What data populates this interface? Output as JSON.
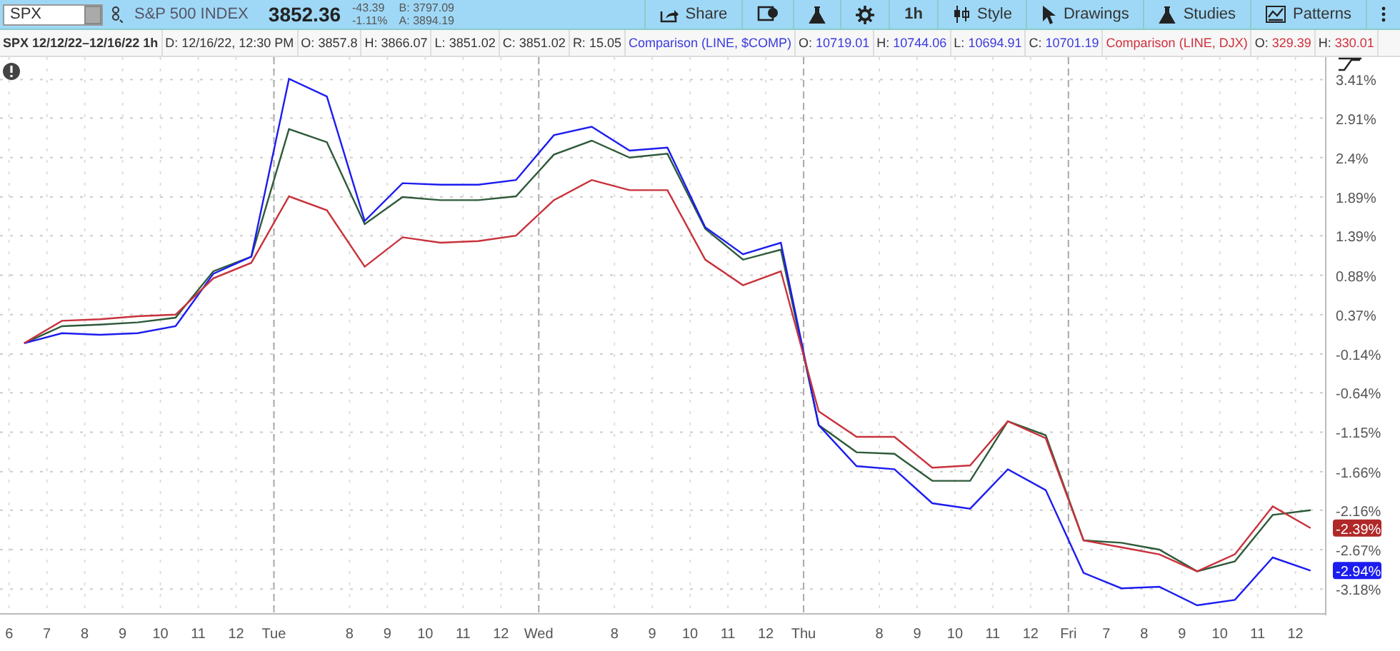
{
  "toolbar": {
    "symbol": "SPX",
    "description": "S&P 500 INDEX",
    "last": "3852.36",
    "change": "-43.39",
    "change_pct": "-1.11%",
    "bid": "B: 3797.09",
    "ask": "A: 3894.19",
    "buttons": [
      {
        "kind": "share",
        "label": "Share"
      },
      {
        "kind": "alert"
      },
      {
        "kind": "flask"
      },
      {
        "kind": "gear"
      },
      {
        "kind": "period",
        "label": "1h"
      },
      {
        "kind": "style",
        "label": "Style"
      },
      {
        "kind": "drawings",
        "label": "Drawings"
      },
      {
        "kind": "studies",
        "label": "Studies"
      },
      {
        "kind": "patterns",
        "label": "Patterns"
      },
      {
        "kind": "more"
      }
    ]
  },
  "info_bar": [
    {
      "kind": "title",
      "text": "SPX 12/12/22–12/16/22 1h"
    },
    {
      "kind": "field",
      "label": "D:",
      "value": "12/16/22, 12:30 PM"
    },
    {
      "kind": "field",
      "label": "O:",
      "value": "3857.8"
    },
    {
      "kind": "field",
      "label": "H:",
      "value": "3866.07"
    },
    {
      "kind": "field",
      "label": "L:",
      "value": "3851.02"
    },
    {
      "kind": "field",
      "label": "C:",
      "value": "3851.02"
    },
    {
      "kind": "field",
      "label": "R:",
      "value": "15.05"
    },
    {
      "kind": "comparison",
      "text": "Comparison (LINE, $COMP)",
      "color": "#3a3adf"
    },
    {
      "kind": "field",
      "label": "O:",
      "value": "10719.01",
      "color": "#3a3adf"
    },
    {
      "kind": "field",
      "label": "H:",
      "value": "10744.06",
      "color": "#3a3adf"
    },
    {
      "kind": "field",
      "label": "L:",
      "value": "10694.91",
      "color": "#3a3adf"
    },
    {
      "kind": "field",
      "label": "C:",
      "value": "10701.19",
      "color": "#3a3adf"
    },
    {
      "kind": "comparison",
      "text": "Comparison (LINE, DJX)",
      "color": "#d0303c"
    },
    {
      "kind": "field",
      "label": "O:",
      "value": "329.39",
      "color": "#d0303c"
    },
    {
      "kind": "field",
      "label": "H:",
      "value": "330.01",
      "color": "#d0303c"
    }
  ],
  "chart": {
    "price_badges": [
      {
        "text": "-2.39%",
        "color": "#b02828"
      },
      {
        "text": "-2.94%",
        "color": "#1c1cf0"
      }
    ],
    "chart_data": {
      "type": "line",
      "categories": [
        "6",
        "7",
        "8",
        "9",
        "10",
        "11",
        "12",
        "Tue",
        null,
        "8",
        "9",
        "10",
        "11",
        "12",
        "Wed",
        null,
        "8",
        "9",
        "10",
        "11",
        "12",
        "Thu",
        null,
        "8",
        "9",
        "10",
        "11",
        "12",
        "Fri",
        "7",
        "8",
        "9",
        "10",
        "11",
        "12"
      ],
      "series": [
        {
          "color": "#2e5a3a",
          "values": [
            0,
            0.22,
            0.24,
            0.27,
            0.33,
            0.93,
            1.12,
            2.77,
            2.6,
            1.54,
            1.89,
            1.85,
            1.85,
            1.9,
            2.44,
            2.62,
            2.4,
            2.45,
            1.48,
            1.08,
            1.21,
            -1.06,
            -1.41,
            -1.43,
            -1.78,
            -1.78,
            -1.01,
            -1.19,
            -2.55,
            -2.58,
            -2.67,
            -2.95,
            -2.82,
            -2.22,
            -2.16
          ]
        },
        {
          "color": "#1c1cf0",
          "values": [
            0,
            0.13,
            0.11,
            0.13,
            0.22,
            0.9,
            1.12,
            3.42,
            3.19,
            1.58,
            2.07,
            2.05,
            2.05,
            2.11,
            2.69,
            2.8,
            2.49,
            2.53,
            1.5,
            1.15,
            1.3,
            -1.06,
            -1.59,
            -1.63,
            -2.07,
            -2.14,
            -1.63,
            -1.9,
            -2.97,
            -3.17,
            -3.15,
            -3.39,
            -3.32,
            -2.77,
            -2.94
          ]
        },
        {
          "color": "#c8323c",
          "values": [
            0,
            0.29,
            0.31,
            0.35,
            0.37,
            0.84,
            1.04,
            1.9,
            1.72,
            0.99,
            1.37,
            1.3,
            1.32,
            1.39,
            1.85,
            2.11,
            1.98,
            1.98,
            1.08,
            0.75,
            0.93,
            -0.88,
            -1.21,
            -1.21,
            -1.61,
            -1.58,
            -1.01,
            -1.23,
            -2.55,
            -2.64,
            -2.73,
            -2.95,
            -2.73,
            -2.11,
            -2.39
          ]
        }
      ],
      "ylim": [
        -3.5,
        3.7
      ],
      "grid": true,
      "yticks": [
        {
          "value": 3.41,
          "label": "3.41%"
        },
        {
          "value": 2.91,
          "label": "2.91%"
        },
        {
          "value": 2.4,
          "label": "2.4%"
        },
        {
          "value": 1.89,
          "label": "1.89%"
        },
        {
          "value": 1.39,
          "label": "1.39%"
        },
        {
          "value": 0.88,
          "label": "0.88%"
        },
        {
          "value": 0.37,
          "label": "0.37%"
        },
        {
          "value": -0.14,
          "label": "-0.14%"
        },
        {
          "value": -0.64,
          "label": "-0.64%"
        },
        {
          "value": -1.15,
          "label": "-1.15%"
        },
        {
          "value": -1.66,
          "label": "-1.66%"
        },
        {
          "value": -2.16,
          "label": "-2.16%"
        },
        {
          "value": -2.67,
          "label": "-2.67%"
        },
        {
          "value": -3.18,
          "label": "-3.18%"
        }
      ]
    }
  }
}
